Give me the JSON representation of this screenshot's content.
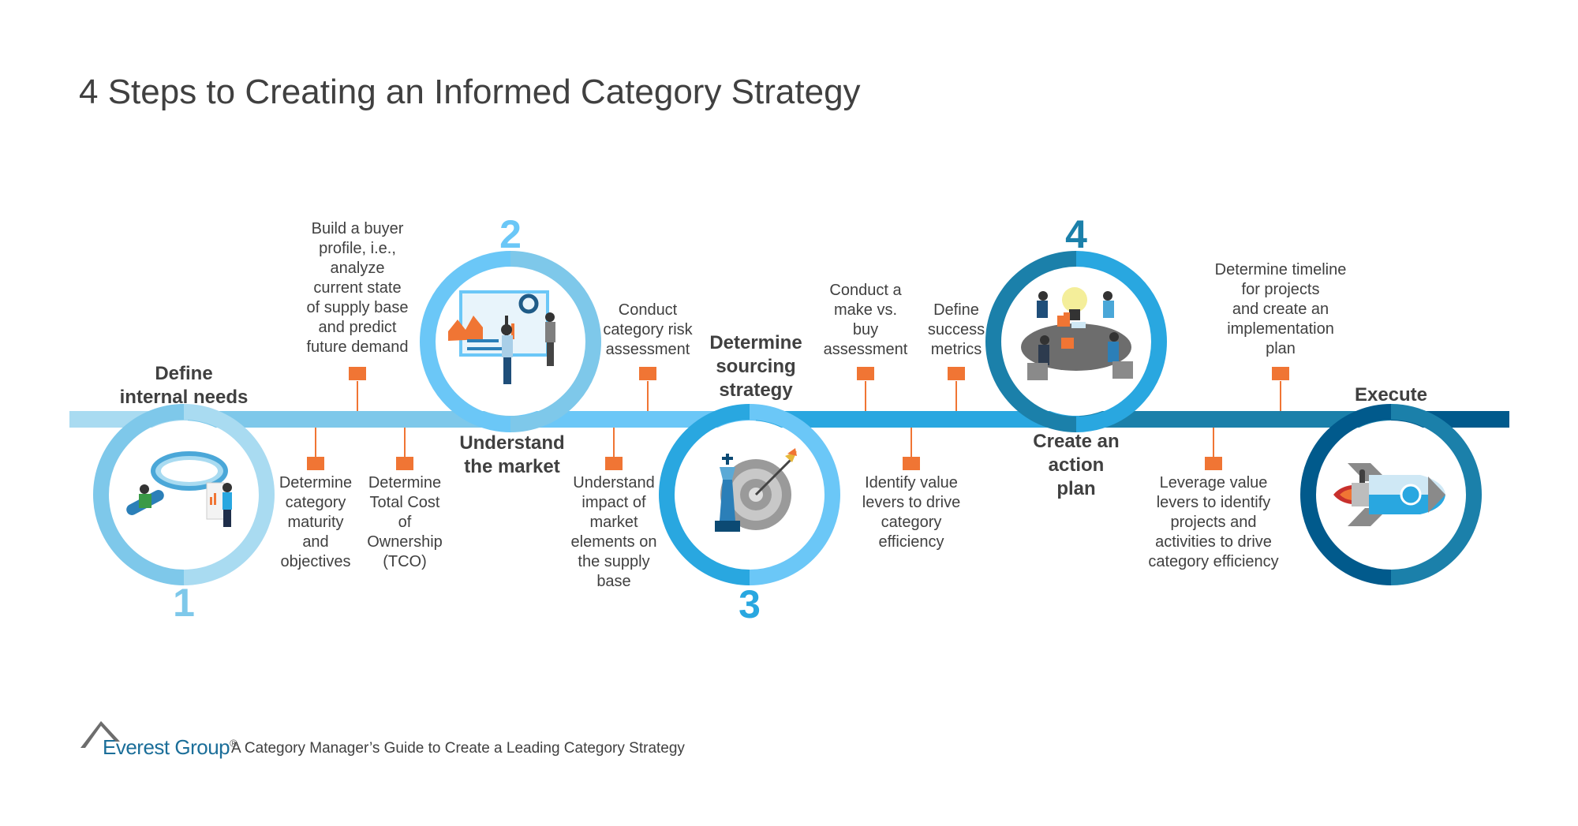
{
  "title": "4 Steps to Creating an Informed Category Strategy",
  "colors": {
    "step1": "#7ec8ea",
    "step1_light": "#a9dbf1",
    "step2": "#6bc7f7",
    "step3": "#29a7e0",
    "step4": "#1b80aa",
    "execute": "#015a8c",
    "marker": "#f07534",
    "text": "#404040"
  },
  "steps": [
    {
      "number": "1",
      "heading": "Define internal needs",
      "heading_lines": [
        "Define",
        "internal needs"
      ],
      "icon": "magnifier-analysts-icon",
      "activities": [
        {
          "lines": [
            "Build a buyer",
            "profile, i.e.,",
            "analyze",
            "current state",
            "of supply base",
            "and predict",
            "future demand"
          ],
          "side": "above"
        },
        {
          "lines": [
            "Determine",
            "category",
            "maturity",
            "and",
            "objectives"
          ],
          "side": "below"
        },
        {
          "lines": [
            "Determine",
            "Total Cost",
            "of",
            "Ownership",
            "(TCO)"
          ],
          "side": "below"
        }
      ]
    },
    {
      "number": "2",
      "heading": "Understand the market",
      "heading_lines": [
        "Understand",
        "the market"
      ],
      "icon": "dashboard-presentation-icon",
      "activities": [
        {
          "lines": [
            "Conduct",
            "category risk",
            "assessment"
          ],
          "side": "above"
        },
        {
          "lines": [
            "Understand",
            "impact of",
            "market",
            "elements on",
            "the supply",
            "base"
          ],
          "side": "below"
        }
      ]
    },
    {
      "number": "3",
      "heading": "Determine sourcing strategy",
      "heading_lines": [
        "Determine",
        "sourcing",
        "strategy"
      ],
      "icon": "chess-king-target-icon",
      "activities": [
        {
          "lines": [
            "Conduct a",
            "make vs.",
            "buy",
            "assessment"
          ],
          "side": "above"
        },
        {
          "lines": [
            "Define",
            "success",
            "metrics"
          ],
          "side": "above"
        },
        {
          "lines": [
            "Identify value",
            "levers to drive",
            "category",
            "efficiency"
          ],
          "side": "below"
        }
      ]
    },
    {
      "number": "4",
      "heading": "Create an action plan",
      "heading_lines": [
        "Create an",
        "action",
        "plan"
      ],
      "icon": "team-meeting-lightbulb-icon",
      "activities": [
        {
          "lines": [
            "Determine timeline",
            "for projects",
            "and create an",
            "implementation",
            "plan"
          ],
          "side": "above"
        },
        {
          "lines": [
            "Leverage value",
            "levers to identify",
            "projects and",
            "activities to drive",
            "category efficiency"
          ],
          "side": "below"
        }
      ]
    },
    {
      "number": "",
      "heading": "Execute",
      "heading_lines": [
        "Execute"
      ],
      "icon": "rocket-icon",
      "activities": []
    }
  ],
  "footer": {
    "brand": "Everest Group",
    "registered": "®",
    "subtitle": "A Category Manager’s Guide to Create a Leading Category Strategy"
  }
}
